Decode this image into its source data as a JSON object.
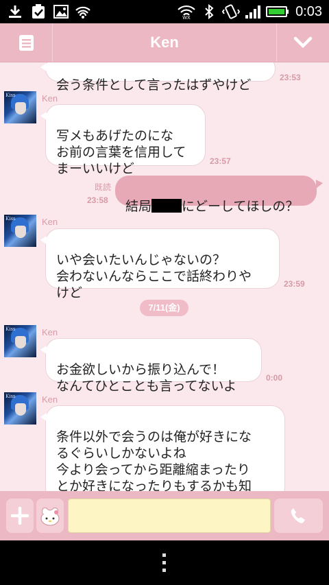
{
  "status_bar": {
    "time": "0:03",
    "icons": [
      "download-icon",
      "clipboard-check-icon",
      "image-icon",
      "wifi-hotspot-icon",
      "wifi-icon",
      "bluetooth-icon",
      "vibrate-icon",
      "signal-icon",
      "battery-icon"
    ]
  },
  "header": {
    "title": "Ken",
    "menu_icon": "menu-icon",
    "collapse_icon": "chevron-down-icon"
  },
  "messages": [
    {
      "sender": "",
      "text": "会う条件として言ったはずやけど",
      "time": "23:53"
    },
    {
      "sender": "Ken",
      "text": "写メもあげたのにな\nお前の言葉を信用して\nまーいいけど",
      "time": "23:57"
    },
    {
      "mine": true,
      "read": "既読",
      "text_before": "結局",
      "text_after": "にどーしてほしの？",
      "time": "23:58"
    },
    {
      "sender": "Ken",
      "text": "いや会いたいんじゃないの？\n会わないんならここで話終わりや\nけど",
      "time": "23:59"
    },
    {
      "date": "7/11(金)"
    },
    {
      "sender": "Ken",
      "text": "お金欲しいから振り込んで！\nなんてひとことも言ってないよ",
      "time": "0:00"
    },
    {
      "sender": "Ken",
      "text": "条件以外で会うのは俺が好きにな\nるぐらいしかないよね\n今より会ってから距離縮まったり\nとか好きになったりもするかも知\nれないよね"
    }
  ],
  "input_bar": {
    "add_icon": "plus-icon",
    "sticker_icon": "sticker-icon",
    "call_icon": "phone-icon",
    "value": ""
  },
  "nav_bar": {
    "menu_icon": "overflow-menu-icon"
  },
  "colors": {
    "header": "#ecb8c3",
    "chat_background": "#fbe8ec",
    "own_bubble": "#e8a9b6",
    "timestamp": "#d79aa7",
    "input_field": "#fdf6c4"
  }
}
